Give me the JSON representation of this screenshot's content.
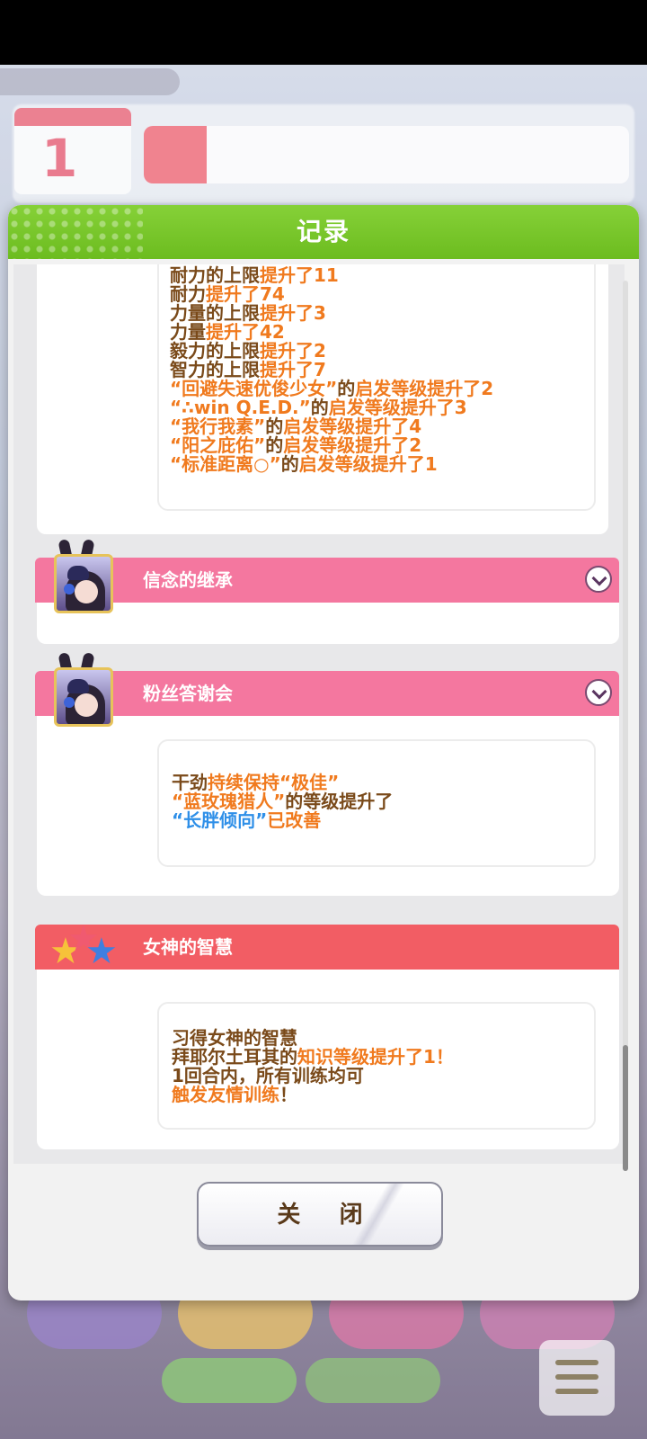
{
  "dialog": {
    "title": "记录",
    "close_label": "关 闭"
  },
  "section1": {
    "lines": [
      [
        {
          "t": "耐力的上限",
          "c": "c-dark"
        },
        {
          "t": "提升了11",
          "c": "c-orange"
        }
      ],
      [
        {
          "t": "耐力",
          "c": "c-dark"
        },
        {
          "t": "提升了74",
          "c": "c-orange"
        }
      ],
      [
        {
          "t": "力量的上限",
          "c": "c-dark"
        },
        {
          "t": "提升了3",
          "c": "c-orange"
        }
      ],
      [
        {
          "t": "力量",
          "c": "c-dark"
        },
        {
          "t": "提升了42",
          "c": "c-orange"
        }
      ],
      [
        {
          "t": "毅力的上限",
          "c": "c-dark"
        },
        {
          "t": "提升了2",
          "c": "c-orange"
        }
      ],
      [
        {
          "t": "智力的上限",
          "c": "c-dark"
        },
        {
          "t": "提升了7",
          "c": "c-orange"
        }
      ],
      [
        {
          "t": "“回避失速优俊少女”",
          "c": "c-orange"
        },
        {
          "t": "的",
          "c": "c-dark"
        },
        {
          "t": "启发等级提升了2",
          "c": "c-orange"
        }
      ],
      [
        {
          "t": "“∴win Q.E.D.”",
          "c": "c-orange"
        },
        {
          "t": "的",
          "c": "c-dark"
        },
        {
          "t": "启发等级提升了3",
          "c": "c-orange"
        }
      ],
      [
        {
          "t": "“我行我素”",
          "c": "c-orange"
        },
        {
          "t": "的",
          "c": "c-dark"
        },
        {
          "t": "启发等级提升了4",
          "c": "c-orange"
        }
      ],
      [
        {
          "t": "“阳之庇佑”",
          "c": "c-orange"
        },
        {
          "t": "的",
          "c": "c-dark"
        },
        {
          "t": "启发等级提升了2",
          "c": "c-orange"
        }
      ],
      [
        {
          "t": "“标准距离○”",
          "c": "c-orange"
        },
        {
          "t": "的",
          "c": "c-dark"
        },
        {
          "t": "启发等级提升了1",
          "c": "c-orange"
        }
      ]
    ]
  },
  "section2": {
    "title": "信念的继承"
  },
  "section3": {
    "title": "粉丝答谢会",
    "lines": [
      [
        {
          "t": "干劲",
          "c": "c-dark"
        },
        {
          "t": "持续保持“极佳”",
          "c": "c-orange"
        }
      ],
      [
        {
          "t": "“蓝玫瑰猎人”",
          "c": "c-orange"
        },
        {
          "t": "的等级提升了",
          "c": "c-dark"
        }
      ],
      [
        {
          "t": "“长胖倾向”",
          "c": "c-blue"
        },
        {
          "t": "已改善",
          "c": "c-orange"
        }
      ]
    ]
  },
  "section4": {
    "title": "女神的智慧",
    "lines": [
      [
        {
          "t": "习得女神的智慧",
          "c": "c-dark"
        }
      ],
      [
        {
          "t": "拜耶尔土耳其的",
          "c": "c-dark"
        },
        {
          "t": "知识等级提升了1！",
          "c": "c-orange"
        }
      ],
      [
        {
          "t": "1回合内，所有训练均可",
          "c": "c-dark"
        }
      ],
      [
        {
          "t": "触发友情训练",
          "c": "c-orange"
        },
        {
          "t": "！",
          "c": "c-dark"
        }
      ]
    ]
  },
  "background": {
    "date_number": "1"
  }
}
